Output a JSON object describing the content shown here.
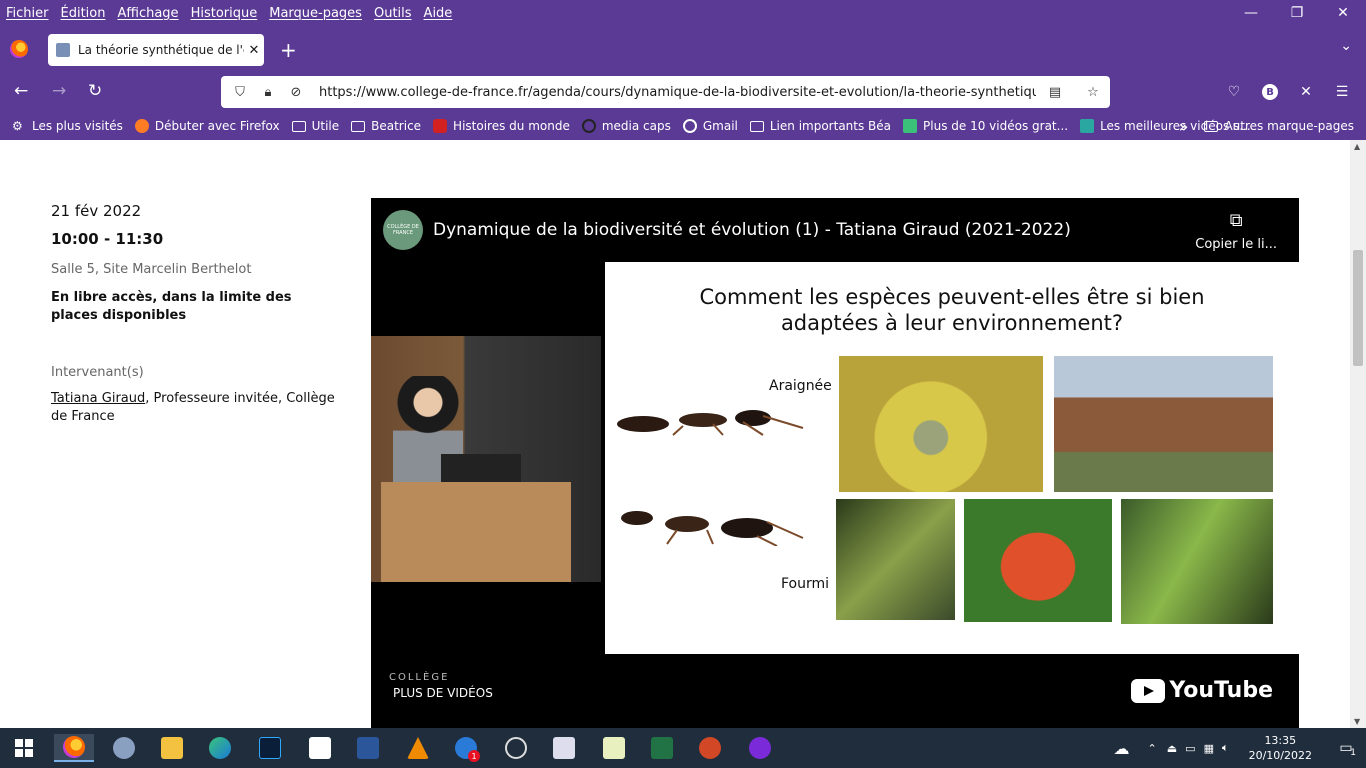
{
  "menu": {
    "items": [
      "Fichier",
      "Édition",
      "Affichage",
      "Historique",
      "Marque-pages",
      "Outils",
      "Aide"
    ]
  },
  "window_controls": {
    "minimize": "—",
    "restore": "❐",
    "close": "✕"
  },
  "tab": {
    "title": "La théorie synthétique de l'évolution",
    "close": "✕",
    "new": "+"
  },
  "address_bar": {
    "url": "https://www.college-de-france.fr/agenda/cours/dynamique-de-la-biodiversite-et-evolution/la-theorie-synthetique-de-"
  },
  "account": {
    "initial": "B"
  },
  "bookmarks": {
    "items": [
      "Les plus visités",
      "Débuter avec Firefox",
      "Utile",
      "Beatrice",
      "Histoires du monde",
      "media caps",
      "Gmail",
      "Lien importants Béa",
      "Plus de 10 vidéos grat...",
      "Les meilleures vidéos s..."
    ],
    "overflow": "»",
    "other": "Autres marque-pages"
  },
  "event": {
    "date": "21 fév 2022",
    "time": "10:00 - 11:30",
    "room": "Salle 5, Site Marcelin Berthelot",
    "access": "En libre accès, dans la limite des places disponibles",
    "speakers_heading": "Intervenant(s)",
    "speaker_name": "Tatiana Giraud",
    "speaker_role": ", Professeure invitée, Collège de France"
  },
  "video": {
    "channel_logo": "COLLÈGE DE FRANCE",
    "title": "Dynamique de la biodiversité et évolution (1) - Tatiana Giraud (2021-2022)",
    "copy_link": "Copier le li...",
    "more_videos": "PLUS DE VIDÉOS",
    "youtube": "YouTube",
    "watermark": "COLLÈGE",
    "slide": {
      "title_line1": "Comment les espèces peuvent-elles être si bien",
      "title_line2": "adaptées à leur environnement?",
      "label_spider": "Araignée",
      "label_ant": "Fourmi"
    }
  },
  "taskbar": {
    "clock_time": "13:35",
    "clock_date": "20/10/2022",
    "notification_count": "1",
    "mail_badge": "1"
  }
}
